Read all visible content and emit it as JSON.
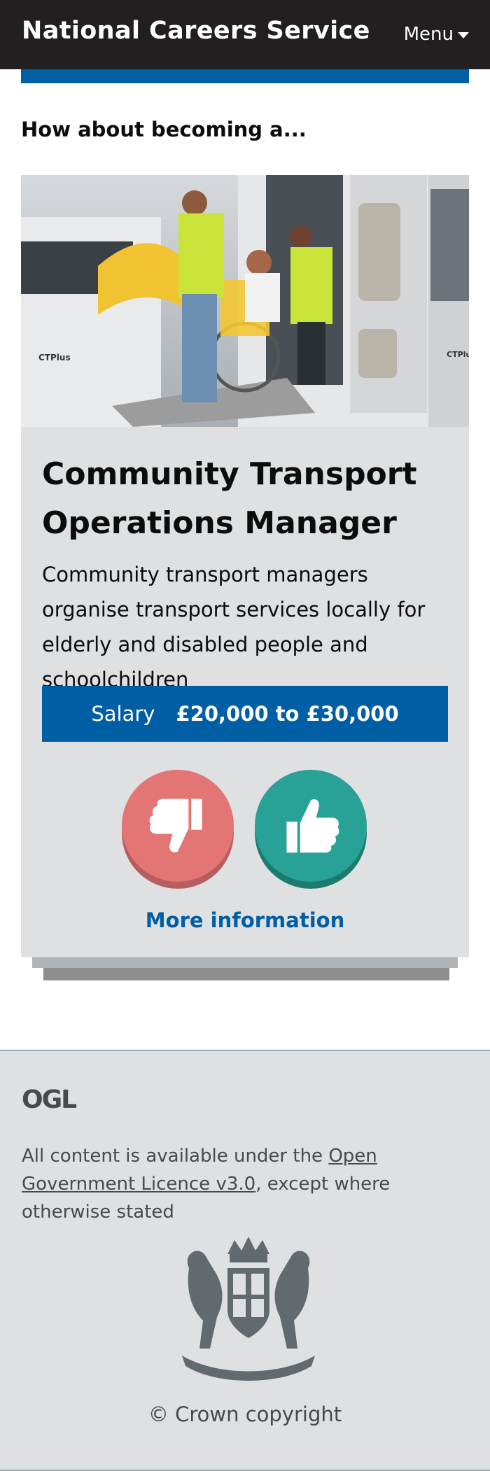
{
  "header": {
    "brand": "National Careers Service",
    "menu_label": "Menu"
  },
  "lead": "How about becoming a...",
  "career": {
    "title": "Community Transport Operations Manager",
    "description": "Community transport managers organise transport services locally for elderly and disabled people and schoolchildren",
    "salary_label": "Salary",
    "salary_value": "£20,000 to £30,000",
    "more_info": "More information",
    "photo_badge": "CTPlus"
  },
  "footer": {
    "logo_text": "OGL",
    "licence_prefix": "All content is available under the ",
    "licence_link": "Open Government Licence v3.0",
    "licence_suffix": ", except where otherwise stated",
    "copyright": "© Crown copyright"
  },
  "colors": {
    "header_bg": "#231f20",
    "brand_blue": "#005ea5",
    "card_bg": "#dee0e2",
    "dislike": "#e37575",
    "like": "#28a197"
  },
  "icons": [
    "thumbs-down-icon",
    "thumbs-up-icon",
    "caret-down-icon",
    "ogl-logo",
    "royal-coat-of-arms"
  ]
}
